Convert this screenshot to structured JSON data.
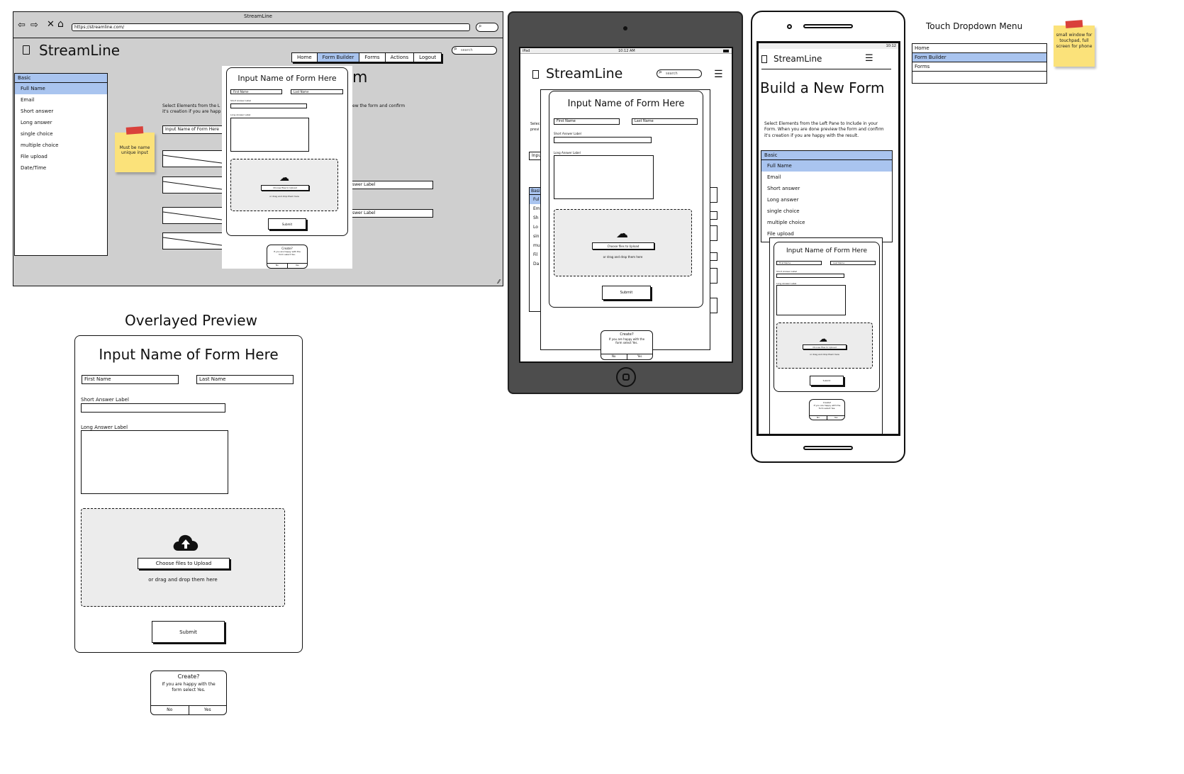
{
  "desktop": {
    "window_title": "StreamLine",
    "url": "https://streamline.com/",
    "logo": "StreamLine",
    "nav": [
      "Home",
      "Form Builder",
      "Forms",
      "Actions",
      "Logout"
    ],
    "search_placeholder": "search",
    "heading_fragment": "m",
    "instructions": [
      "Select Elements from the L",
      "it's creation if you are happ"
    ],
    "instructions_right": "ew the form and confirm",
    "form_name_input": "Input Name of Form Here",
    "answer_label_1": "swer Label",
    "answer_label_2": "swer Label",
    "sticky_note": "Must be name unique input"
  },
  "sidebar": {
    "group": "Basic",
    "items": [
      "Full Name",
      "Email",
      "Short answer",
      "Long answer",
      "single choice",
      "multiple choice",
      "File upload",
      "Date/Time"
    ],
    "selected": "Full Name"
  },
  "form": {
    "title": "Input Name of Form Here",
    "first_name": "First Name",
    "last_name": "Last Name",
    "short_answer_label": "Short Answer Label",
    "long_answer_label": "Long Answer Label",
    "upload_button": "Choose files to Upload",
    "upload_hint": "or drag and drop them here",
    "submit": "Submit"
  },
  "dialog": {
    "title": "Create?",
    "message": "If you are happy with the form select Yes.",
    "no": "No",
    "yes": "Yes"
  },
  "overlay_preview": {
    "heading": "Overlayed Preview"
  },
  "tablet": {
    "status_left": "iPad",
    "status_time": "10:12 AM",
    "logo": "StreamLine",
    "search_placeholder": "search",
    "behind": [
      "Selec",
      "previ",
      "Inpu",
      "Basic",
      "Ful",
      "Em",
      "Sh",
      "Lo",
      "sin",
      "mu",
      "Fil",
      "Da"
    ]
  },
  "phone": {
    "status_time": "10:12",
    "logo": "StreamLine",
    "heading": "Build a New Form",
    "instructions": "Select Elements from the Left Pane to Include in your Form. When you are done preview the form and confirm it's creation if you are happy with the result."
  },
  "touch_dropdown": {
    "title": "Touch Dropdown Menu",
    "items": [
      "Home",
      "Form Builder",
      "Forms"
    ],
    "selected": "Form Builder",
    "sticky_note": "small window for touchpad, full screen for phone"
  },
  "colors": {
    "selection": "#a9c4ef",
    "canvas_gray": "#cfcfcf",
    "tablet_body": "#4d4d4d",
    "sticky": "#fbe27a",
    "tape": "#d9413b"
  }
}
